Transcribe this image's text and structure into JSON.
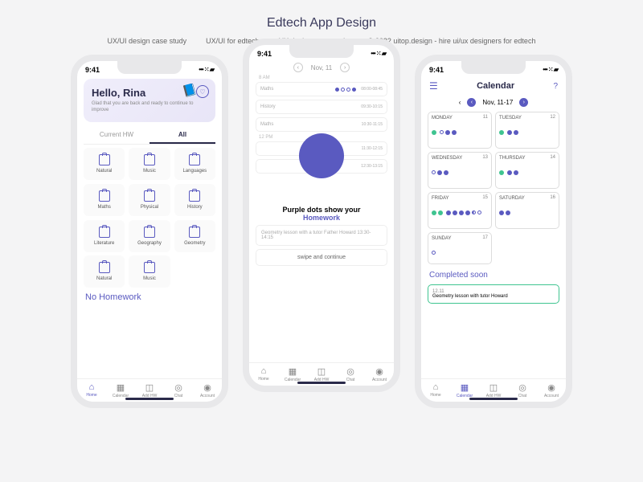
{
  "title": "Edtech App Design",
  "subtitles": [
    "UX/UI design case study",
    "UX/UI for edtech",
    "UX design case study",
    "© 2022 uitop.design - hire ui/ux designers for edtech"
  ],
  "statusbar": {
    "time": "9:41",
    "indicators": "••• ⁙ ▰"
  },
  "phone1": {
    "hello": "Hello, Rina",
    "hello_sub": "Glad that you are back and ready to continue to improve",
    "tabs": [
      "Current HW",
      "All"
    ],
    "subjects": [
      "Natural",
      "Music",
      "Languages",
      "Maths",
      "Physical",
      "History",
      "Literature",
      "Geography",
      "Geometry",
      "Natural",
      "Music"
    ],
    "no_hw": "No Homework"
  },
  "bottombar": [
    "Home",
    "Calendar",
    "Add HW",
    "Chat",
    "Account"
  ],
  "phone2": {
    "date": "Nov, 11",
    "rows": [
      {
        "time": "8 AM",
        "subj": "Maths",
        "rt": "08:00-08:45"
      },
      {
        "time": "",
        "subj": "History",
        "rt": "09:30-10:15"
      },
      {
        "time": "",
        "subj": "Maths",
        "rt": "10:30-11:15"
      },
      {
        "time": "12 PM",
        "subj": "",
        "rt": "11:30-12:15"
      },
      {
        "time": "",
        "subj": "",
        "rt": "12:30-13:15"
      }
    ],
    "msg1": "Purple dots show your",
    "msg2": "Homework",
    "geo": "Geometry lesson with a tutor Father Howard",
    "geo_time": "13:30-14:15",
    "swipe": "swipe and continue"
  },
  "phone3": {
    "title": "Calendar",
    "range": "Nov, 11-17",
    "days": [
      {
        "name": "MONDAY",
        "date": "11"
      },
      {
        "name": "TUESDAY",
        "date": "12"
      },
      {
        "name": "WEDNESDAY",
        "date": "13"
      },
      {
        "name": "THURSDAY",
        "date": "14"
      },
      {
        "name": "FRIDAY",
        "date": "15"
      },
      {
        "name": "SATURDAY",
        "date": "16"
      },
      {
        "name": "SUNDAY",
        "date": "17"
      }
    ],
    "completed": "Completed soon",
    "task_date": "12.11",
    "task": "Geometry lesson with tutor Howard"
  }
}
